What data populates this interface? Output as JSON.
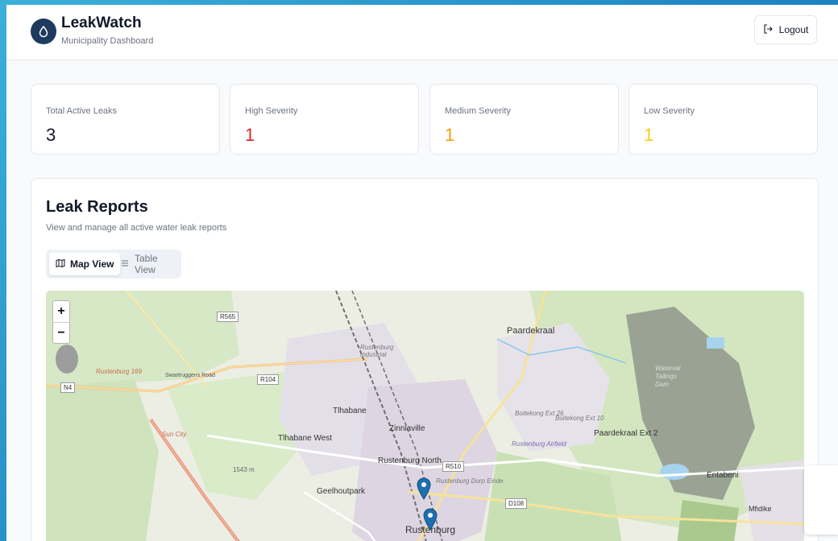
{
  "app": {
    "title": "LeakWatch",
    "subtitle": "Municipality Dashboard",
    "logout_label": "Logout"
  },
  "stats": [
    {
      "label": "Total Active Leaks",
      "value": "3",
      "color": "#111827"
    },
    {
      "label": "High Severity",
      "value": "1",
      "color": "#dc2626"
    },
    {
      "label": "Medium Severity",
      "value": "1",
      "color": "#f59e0b"
    },
    {
      "label": "Low Severity",
      "value": "1",
      "color": "#facc15"
    }
  ],
  "reports": {
    "title": "Leak Reports",
    "subtitle": "View and manage all active water leak reports",
    "tabs": [
      {
        "label": "Map View",
        "active": true
      },
      {
        "label": "Table View",
        "active": false
      }
    ]
  },
  "map": {
    "zoom_in": "+",
    "zoom_out": "−",
    "places": [
      "Paardekraal",
      "Tlhabane",
      "Zinniaville",
      "Tlhabane West",
      "Rustenburg North",
      "Geelhoutpark",
      "Rustenburg",
      "Paardekraal Ext 2",
      "Entabeni",
      "Mfidike",
      "Rustenburg Industrial",
      "Boitekong Ext 26",
      "Boitekong Ext 10",
      "Rustenburg Airfield",
      "Waterval Tailings Dam",
      "Sun City",
      "Rustenburg 169",
      "Rustenburg Dorp Einde"
    ],
    "roads": [
      "R565",
      "R104",
      "N4",
      "R510",
      "D108",
      "Swartruggens Road"
    ],
    "elevation": "1543 m",
    "marker_color": "#1e6fb0"
  }
}
